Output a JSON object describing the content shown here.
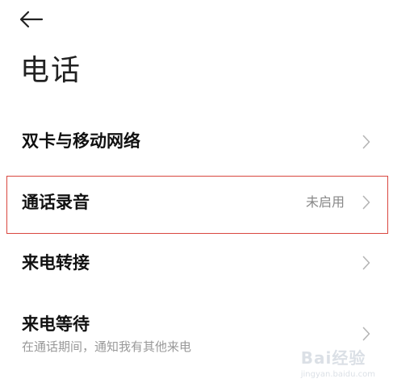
{
  "header": {
    "back_icon": "arrow-left-icon",
    "title": "电话"
  },
  "rows": [
    {
      "title": "双卡与移动网络",
      "value": "",
      "subtitle": ""
    },
    {
      "title": "通话录音",
      "value": "未启用",
      "subtitle": ""
    },
    {
      "title": "来电转接",
      "value": "",
      "subtitle": ""
    },
    {
      "title": "来电等待",
      "value": "",
      "subtitle": "在通话期间，通知我有其他来电"
    }
  ],
  "highlight_color": "#d9473f",
  "watermark": {
    "brand": "Bai经验",
    "site": "jingyan.baidu.com"
  }
}
